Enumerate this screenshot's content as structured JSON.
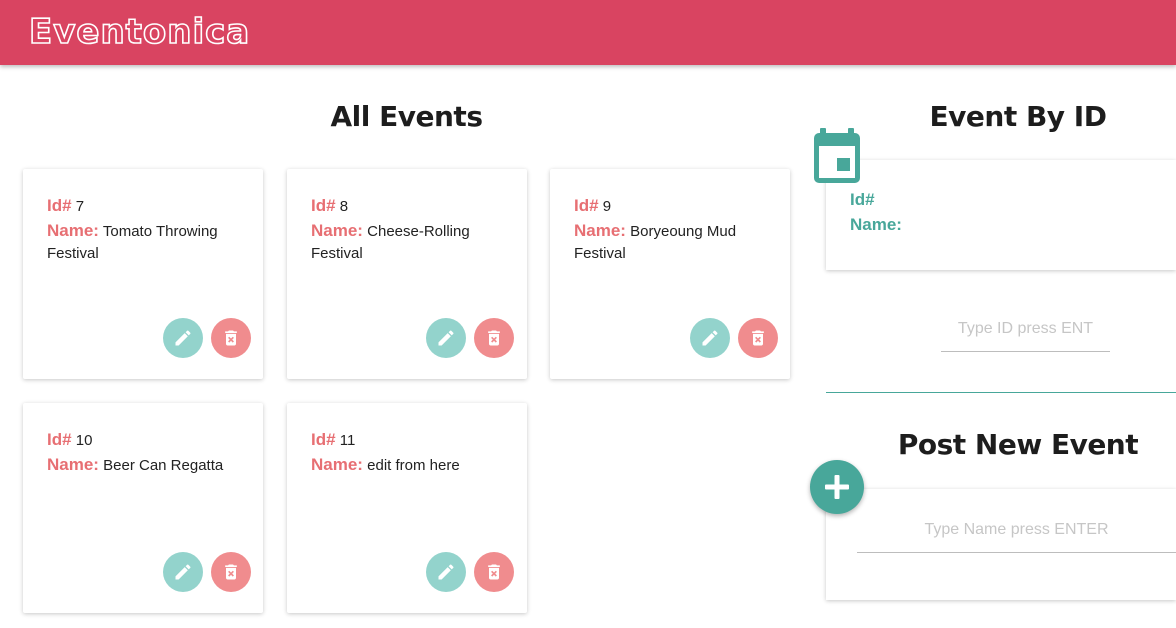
{
  "app": {
    "title": "Eventonica"
  },
  "all_events": {
    "title": "All Events",
    "id_label": "Id#",
    "name_label": "Name:",
    "events": [
      {
        "id": "7",
        "name": "Tomato Throwing Festival"
      },
      {
        "id": "8",
        "name": "Cheese-Rolling Festival"
      },
      {
        "id": "9",
        "name": "Boryeoung Mud Festival"
      },
      {
        "id": "10",
        "name": "Beer Can Regatta"
      },
      {
        "id": "11",
        "name": "edit from here"
      }
    ],
    "edit_icon": "pencil-icon",
    "delete_icon": "trash-can-icon"
  },
  "event_by_id": {
    "title": "Event By ID",
    "icon": "calendar-icon",
    "id_label": "Id#",
    "name_label": "Name:",
    "input_placeholder": "Type ID press ENT"
  },
  "post_new_event": {
    "title": "Post New Event",
    "icon": "plus-icon",
    "input_placeholder": "Type Name press ENTER"
  },
  "colors": {
    "appbar": "#d94461",
    "label_red": "#e76f73",
    "teal": "#48a79a",
    "edit_button": "#93d3cc",
    "delete_button": "#f08c8e"
  }
}
